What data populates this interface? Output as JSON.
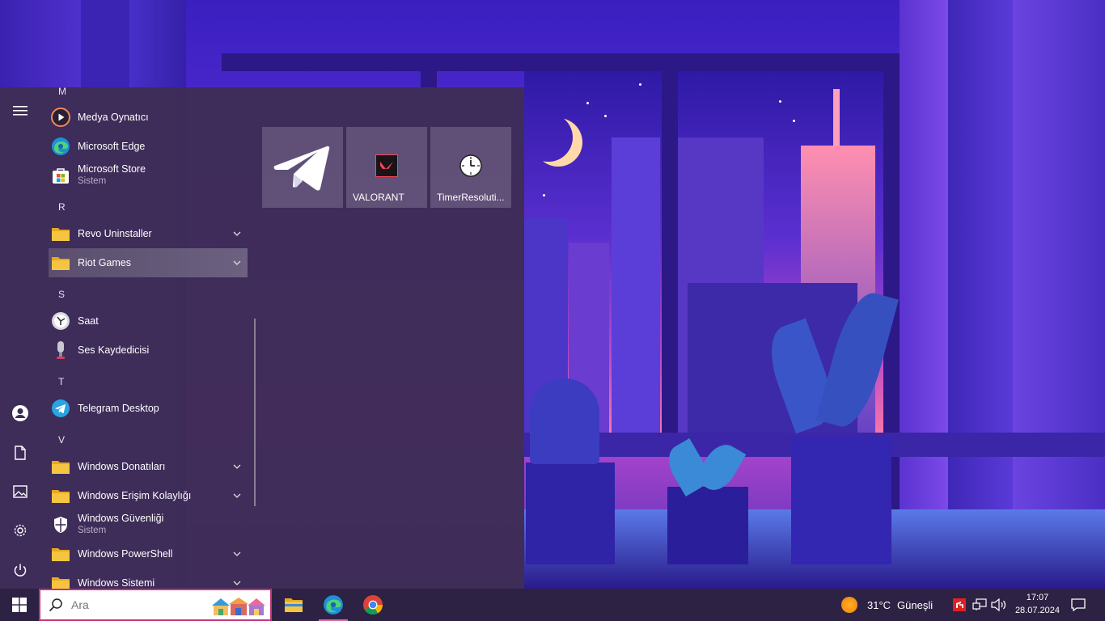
{
  "start_menu": {
    "rail": {
      "menu_icon": "hamburger-icon",
      "user_icon": "user-icon",
      "documents_icon": "document-icon",
      "pictures_icon": "pictures-icon",
      "settings_icon": "gear-icon",
      "power_icon": "power-icon"
    },
    "letters": {
      "m": "M",
      "r": "R",
      "s": "S",
      "t": "T",
      "v": "V"
    },
    "apps": [
      {
        "label": "Medya Oynatıcı",
        "sub": "",
        "icon": "media-player-icon"
      },
      {
        "label": "Microsoft Edge",
        "sub": "",
        "icon": "edge-icon"
      },
      {
        "label": "Microsoft Store",
        "sub": "Sistem",
        "icon": "store-icon"
      },
      {
        "label": "Revo Uninstaller",
        "sub": "",
        "icon": "folder-icon"
      },
      {
        "label": "Riot Games",
        "sub": "",
        "icon": "folder-icon"
      },
      {
        "label": "Saat",
        "sub": "",
        "icon": "clock-icon"
      },
      {
        "label": "Ses Kaydedicisi",
        "sub": "",
        "icon": "microphone-icon"
      },
      {
        "label": "Telegram Desktop",
        "sub": "",
        "icon": "telegram-icon"
      },
      {
        "label": "Windows Donatıları",
        "sub": "",
        "icon": "folder-icon"
      },
      {
        "label": "Windows Erişim Kolaylığı",
        "sub": "",
        "icon": "folder-icon"
      },
      {
        "label": "Windows Güvenliği",
        "sub": "Sistem",
        "icon": "shield-icon"
      },
      {
        "label": "Windows PowerShell",
        "sub": "",
        "icon": "folder-icon"
      },
      {
        "label": "Windows Sistemi",
        "sub": "",
        "icon": "folder-icon"
      }
    ],
    "tiles": [
      {
        "label": "",
        "icon": "telegram-icon"
      },
      {
        "label": "VALORANT",
        "icon": "valorant-icon"
      },
      {
        "label": "TimerResoluti...",
        "icon": "clock-icon"
      }
    ]
  },
  "taskbar": {
    "search_placeholder": "Ara",
    "weather_temp": "31°C",
    "weather_text": "Güneşli",
    "time": "17:07",
    "date": "28.07.2024",
    "pinned": [
      "file-explorer-icon",
      "edge-icon",
      "chrome-icon"
    ]
  },
  "colors": {
    "start_bg": "#3e2c56",
    "taskbar_bg": "#2d2243",
    "search_border": "#c8317a",
    "folder_yellow": "#f5c542"
  }
}
